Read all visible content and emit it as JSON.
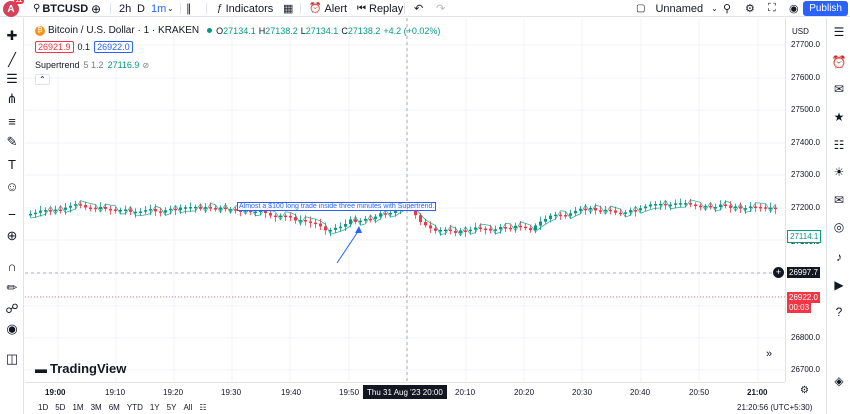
{
  "toolbar": {
    "avatar_letter": "A",
    "avatar_badge": "11",
    "symbol": "BTCUSD",
    "interval_2h": "2h",
    "interval_d": "D",
    "interval_1m": "1m",
    "indicators": "Indicators",
    "alert": "Alert",
    "replay": "Replay",
    "layout_name": "Unnamed",
    "publish": "Publish"
  },
  "legend": {
    "title": "Bitcoin / U.S. Dollar · 1 · KRAKEN",
    "o_label": "O",
    "o_val": "27134.1",
    "h_label": "H",
    "h_val": "27138.2",
    "l_label": "L",
    "l_val": "27134.1",
    "c_label": "C",
    "c_val": "27138.2",
    "change": "+4.2 (+0.02%)",
    "bid": "26921.9",
    "spread": "0.1",
    "ask": "26922.0",
    "indicator_name": "Supertrend",
    "indicator_params": "5 1.2",
    "indicator_value": "27116.9"
  },
  "annotation": "Almost a $100 long trade inside three minutes with Supertrend.",
  "logo_text": "TradingView",
  "price_axis": {
    "currency": "USD",
    "labels": [
      "27700.0",
      "27600.0",
      "27500.0",
      "27400.0",
      "27300.0",
      "27200.0",
      "27100.0",
      "26800.0",
      "26700.0"
    ],
    "supertrend_tag": "27114.1",
    "crosshair_tag": "26997.7",
    "last_price_tag": "26922.0",
    "countdown": "00:03"
  },
  "time_axis": {
    "labels": [
      "19:00",
      "19:10",
      "19:20",
      "19:30",
      "19:40",
      "19:50",
      "20:10",
      "20:20",
      "20:30",
      "20:40",
      "20:50",
      "21:00"
    ],
    "crosshair": "Thu 31 Aug '23   20:00"
  },
  "bottom": {
    "ranges": [
      "1D",
      "5D",
      "1M",
      "3M",
      "6M",
      "YTD",
      "1Y",
      "5Y",
      "All"
    ],
    "clock": "21:20:56 (UTC+5:30)"
  },
  "colors": {
    "up": "#089981",
    "down": "#f23645",
    "accent": "#2962ff"
  }
}
